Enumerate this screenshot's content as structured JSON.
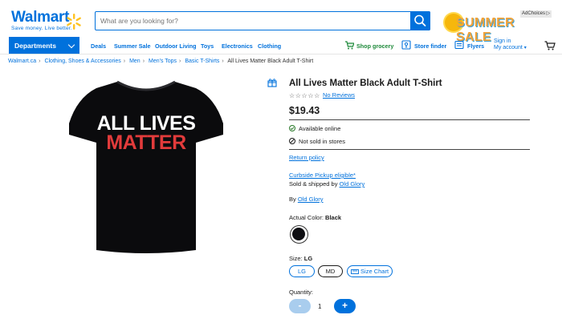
{
  "header": {
    "logo_text": "Walmart",
    "logo_tagline": "Save money. Live better.",
    "search_placeholder": "What are you looking for?",
    "ad_text": "SUMMER SALE",
    "adchoices_label": "AdChoices",
    "brand_color": "#0071dc"
  },
  "nav": {
    "departments_label": "Departments",
    "links": [
      "Deals",
      "Summer Sale",
      "Outdoor Living",
      "Toys",
      "Electronics",
      "Clothing"
    ],
    "shop_grocery": "Shop grocery",
    "store_finder": "Store finder",
    "flyers": "Flyers",
    "signin_line1": "Sign in",
    "signin_line2": "My account"
  },
  "breadcrumb": {
    "items": [
      "Walmart.ca",
      "Clothing, Shoes & Accessories",
      "Men",
      "Men's Tops",
      "Basic T-Shirts"
    ],
    "current": "All Lives Matter Black Adult T-Shirt"
  },
  "product": {
    "image_text_line1": "ALL LIVES",
    "image_text_line2": "MATTER",
    "title": "All Lives Matter Black Adult T-Shirt",
    "stars": "☆☆☆☆☆",
    "reviews_link": "No Reviews",
    "price": "$19.43",
    "availability_online": "Available online",
    "availability_store": "Not sold in stores",
    "return_policy": "Return policy",
    "curbside": "Curbside Pickup eligible*",
    "sold_by_prefix": "Sold & shipped by",
    "sold_by": "Old Glory",
    "by_prefix": "By",
    "brand": "Old Glory",
    "color_label": "Actual Color:",
    "color_value": "Black",
    "size_label": "Size:",
    "size_value": "LG",
    "sizes": [
      "LG",
      "MD"
    ],
    "size_chart": "Size Chart",
    "quantity_label": "Quantity:",
    "quantity": "1",
    "minus": "-",
    "plus": "+"
  }
}
